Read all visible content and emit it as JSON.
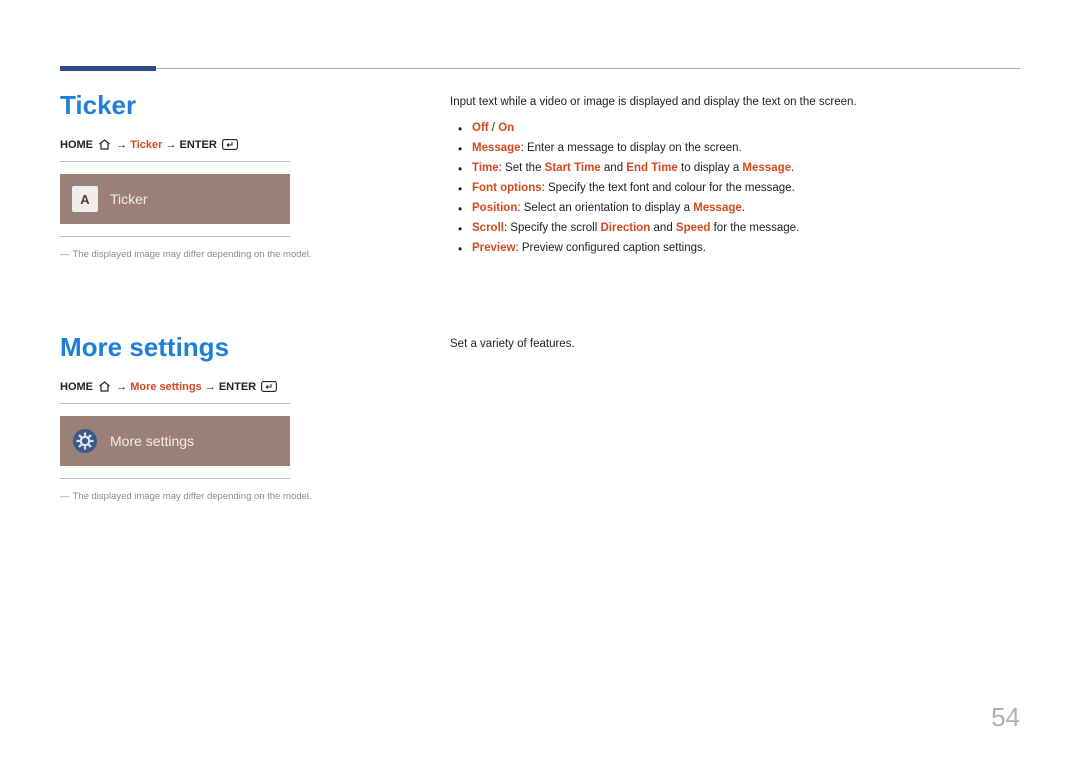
{
  "page_number": "54",
  "sections": {
    "ticker": {
      "title": "Ticker",
      "nav": {
        "home": "HOME",
        "arrow": "→",
        "mid": "Ticker",
        "enter": "ENTER"
      },
      "tile": {
        "badge": "A",
        "label": "Ticker"
      },
      "footnote": "The displayed image may differ depending on the model.",
      "intro": "Input text while a video or image is displayed and display the text on the screen.",
      "bullets": {
        "b1": {
          "off": "Off",
          "slash": " / ",
          "on": "On"
        },
        "b2": {
          "k": "Message",
          "t": ": Enter a message to display on the screen."
        },
        "b3": {
          "k": "Time",
          "t1": ": Set the ",
          "s1": "Start Time",
          "t2": " and ",
          "s2": "End Time",
          "t3": " to display a ",
          "s3": "Message",
          "t4": "."
        },
        "b4": {
          "k": "Font options",
          "t": ": Specify the text font and colour for the message."
        },
        "b5": {
          "k": "Position",
          "t1": ": Select an orientation to display a ",
          "s1": "Message",
          "t2": "."
        },
        "b6": {
          "k": "Scroll",
          "t1": ": Specify the scroll ",
          "s1": "Direction",
          "t2": " and ",
          "s2": "Speed",
          "t3": " for the message."
        },
        "b7": {
          "k": "Preview",
          "t": ": Preview configured caption settings."
        }
      }
    },
    "more": {
      "title": "More settings",
      "nav": {
        "home": "HOME",
        "arrow": "→",
        "mid": "More settings",
        "enter": "ENTER"
      },
      "tile": {
        "label": "More settings"
      },
      "footnote": "The displayed image may differ depending on the model.",
      "intro": "Set a variety of features."
    }
  }
}
